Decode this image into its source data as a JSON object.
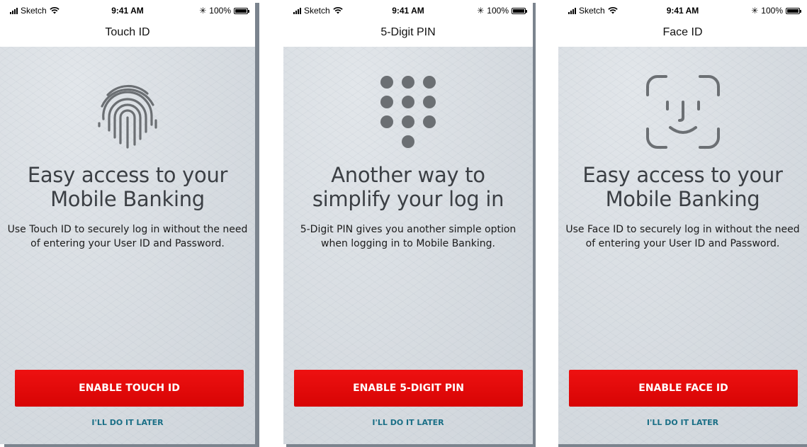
{
  "colors": {
    "primary_button": "#e00808",
    "link": "#1a6f86",
    "icon_gray": "#6b6f73",
    "background": "#d9dee3",
    "shadow": "#7b848e"
  },
  "screens": [
    {
      "status": {
        "carrier": "Sketch",
        "time": "9:41 AM",
        "battery": "100%"
      },
      "nav_title": "Touch ID",
      "icon": "fingerprint-icon",
      "heading_line1": "Easy access to your",
      "heading_line2": "Mobile Banking",
      "description": "Use Touch ID to securely log in without the need of entering your User ID and Password.",
      "enable_label": "ENABLE TOUCH ID",
      "later_label": "I'LL DO IT LATER"
    },
    {
      "status": {
        "carrier": "Sketch",
        "time": "9:41 AM",
        "battery": "100%"
      },
      "nav_title": "5-Digit PIN",
      "icon": "pin-keypad-icon",
      "heading_line1": "Another way to",
      "heading_line2": "simplify your log in",
      "description": "5-Digit PIN gives you another simple option when logging in to Mobile Banking.",
      "enable_label": "ENABLE 5-DIGIT PIN",
      "later_label": "I'LL DO IT LATER"
    },
    {
      "status": {
        "carrier": "Sketch",
        "time": "9:41 AM",
        "battery": "100%"
      },
      "nav_title": "Face ID",
      "icon": "face-id-icon",
      "heading_line1": "Easy access to your",
      "heading_line2": "Mobile Banking",
      "description": "Use Face ID to securely log in without the need of entering your User ID and Password.",
      "enable_label": "ENABLE FACE ID",
      "later_label": "I'LL DO IT LATER"
    }
  ]
}
